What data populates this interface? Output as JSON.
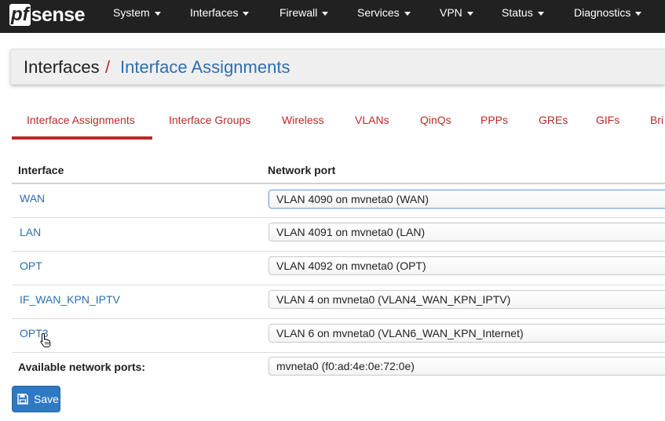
{
  "navbar": {
    "logo": {
      "box": "pf",
      "rest": "sense"
    },
    "items": [
      {
        "label": "System"
      },
      {
        "label": "Interfaces"
      },
      {
        "label": "Firewall"
      },
      {
        "label": "Services"
      },
      {
        "label": "VPN"
      },
      {
        "label": "Status"
      },
      {
        "label": "Diagnostics"
      }
    ]
  },
  "breadcrumb": {
    "parent": "Interfaces",
    "separator": "/",
    "current": "Interface Assignments"
  },
  "tabs": [
    {
      "label": "Interface Assignments",
      "active": true
    },
    {
      "label": "Interface Groups"
    },
    {
      "label": "Wireless"
    },
    {
      "label": "VLANs"
    },
    {
      "label": "QinQs"
    },
    {
      "label": "PPPs"
    },
    {
      "label": "GREs"
    },
    {
      "label": "GIFs"
    },
    {
      "label": "Bri"
    }
  ],
  "table": {
    "headers": {
      "interface": "Interface",
      "port": "Network port"
    },
    "rows": [
      {
        "interface": "WAN",
        "port": "VLAN 4090 on mvneta0 (WAN)"
      },
      {
        "interface": "LAN",
        "port": "VLAN 4091 on mvneta0 (LAN)"
      },
      {
        "interface": "OPT",
        "port": "VLAN 4092 on mvneta0 (OPT)"
      },
      {
        "interface": "IF_WAN_KPN_IPTV",
        "port": "VLAN 4 on mvneta0 (VLAN4_WAN_KPN_IPTV)"
      },
      {
        "interface": "OPT3",
        "port": "VLAN 6 on mvneta0 (VLAN6_WAN_KPN_Internet)"
      }
    ],
    "available": {
      "label": "Available network ports:",
      "port": "mvneta0 (f0:ad:4e:0e:72:0e)"
    }
  },
  "save_button": {
    "label": "Save",
    "icon": "floppy-disk-icon"
  },
  "colors": {
    "navbar": "#212121",
    "tab_accent": "#b92a2a",
    "link": "#2e6fae",
    "button": "#2f79c3"
  }
}
